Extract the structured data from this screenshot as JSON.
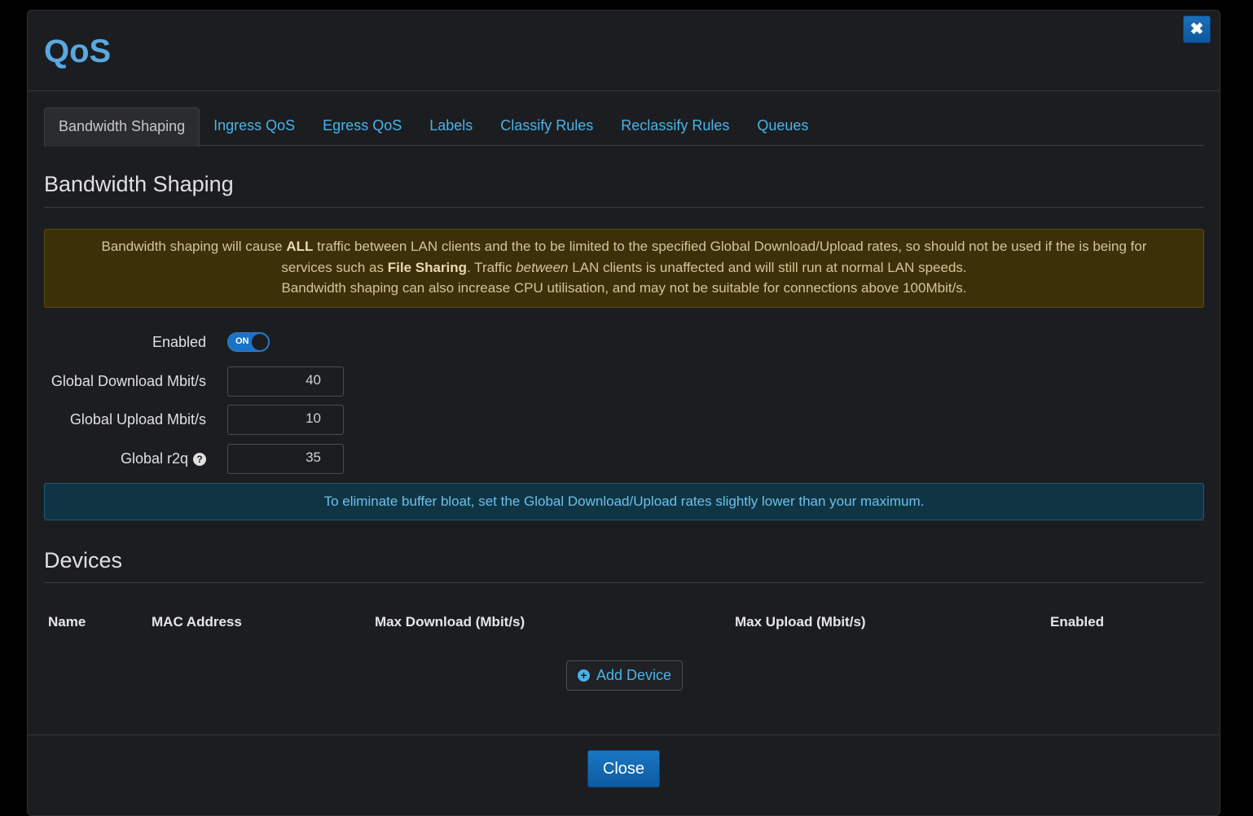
{
  "modal": {
    "title": "QoS",
    "close_icon": "✖"
  },
  "tabs": [
    {
      "label": "Bandwidth Shaping",
      "active": true
    },
    {
      "label": "Ingress QoS"
    },
    {
      "label": "Egress QoS"
    },
    {
      "label": "Labels"
    },
    {
      "label": "Classify Rules"
    },
    {
      "label": "Reclassify Rules"
    },
    {
      "label": "Queues"
    }
  ],
  "bandwidth_shaping": {
    "heading": "Bandwidth Shaping",
    "warning": {
      "line1_pre": "Bandwidth shaping will cause ",
      "line1_bold": "ALL",
      "line1_post": " traffic between LAN clients and the to be limited to the specified Global Download/Upload rates, so should not be used if the is being for",
      "line2_pre": "services such as ",
      "line2_bold": "File Sharing",
      "line2_mid": ". Traffic ",
      "line2_em": "between",
      "line2_post": " LAN clients is unaffected and will still run at normal LAN speeds.",
      "line3": "Bandwidth shaping can also increase CPU utilisation, and may not be suitable for connections above 100Mbit/s."
    },
    "enabled_label": "Enabled",
    "enabled_toggle": "ON",
    "download_label": "Global Download Mbit/s",
    "download_value": "40",
    "upload_label": "Global Upload Mbit/s",
    "upload_value": "10",
    "r2q_label": "Global r2q",
    "r2q_value": "35",
    "help_icon": "?",
    "info": "To eliminate buffer bloat, set the Global Download/Upload rates slightly lower than your maximum."
  },
  "devices": {
    "heading": "Devices",
    "columns": [
      "Name",
      "MAC Address",
      "Max Download (Mbit/s)",
      "Max Upload (Mbit/s)",
      "Enabled"
    ],
    "add_icon": "+",
    "add_label": "Add Device"
  },
  "footer": {
    "close_label": "Close"
  },
  "colors": {
    "accent": "#4ab3e8",
    "title": "#5aa8e0",
    "primary_button": "#1a6fb8",
    "warning_bg": "#3b3006",
    "info_bg": "#0f3545"
  }
}
